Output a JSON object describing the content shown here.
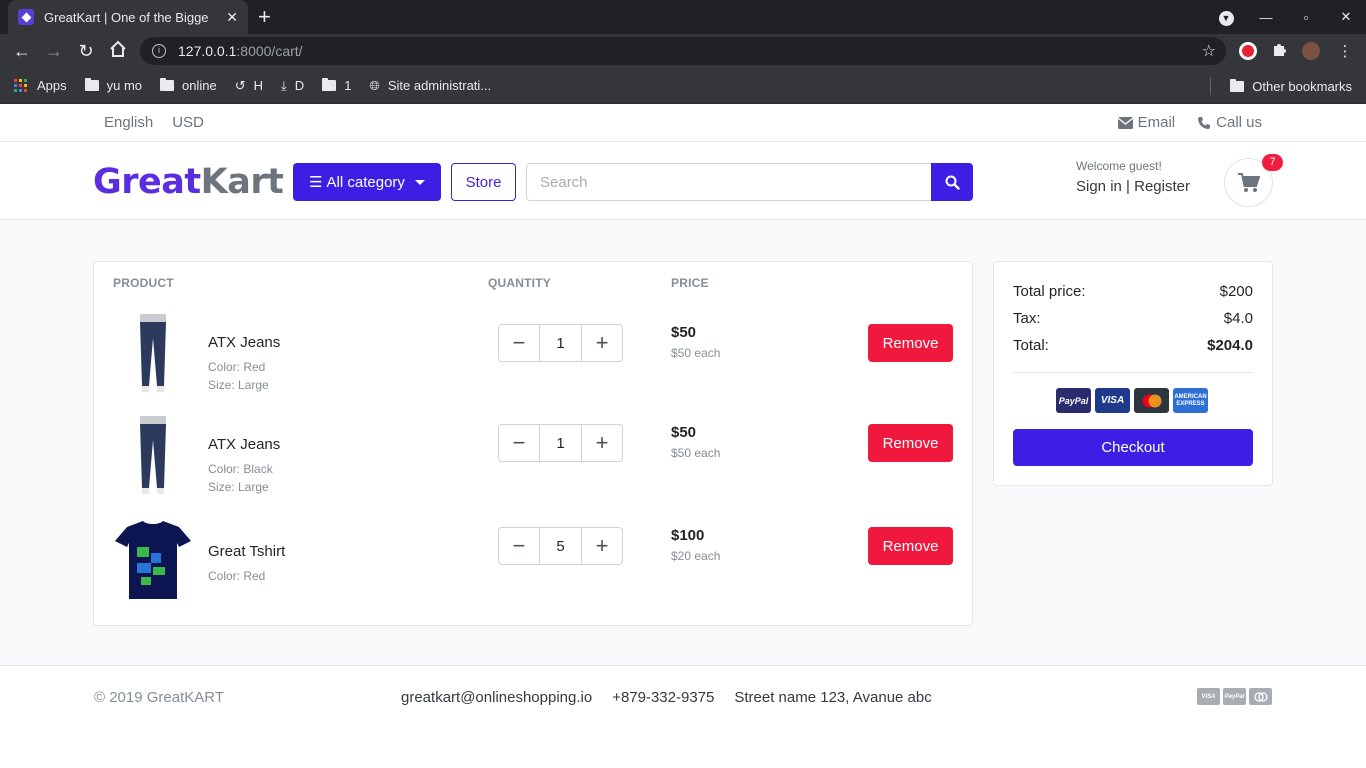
{
  "browser": {
    "tab_title": "GreatKart | One of the Bigge",
    "url_host": "127.0.0.1",
    "url_rest": ":8000/cart/",
    "bookmarks": [
      {
        "label": "Apps"
      },
      {
        "label": "yu mo"
      },
      {
        "label": "online"
      },
      {
        "label": "H"
      },
      {
        "label": "D"
      },
      {
        "label": "1"
      },
      {
        "label": "Site administrati..."
      }
    ],
    "other_bookmarks": "Other bookmarks"
  },
  "topbar": {
    "language": "English",
    "currency": "USD",
    "email": "Email",
    "call": "Call us"
  },
  "header": {
    "logo_part1": "Great",
    "logo_part2": "Kart",
    "category_label": "All category",
    "store_label": "Store",
    "search_placeholder": "Search",
    "welcome": "Welcome guest!",
    "signin": "Sign in",
    "separator": "|",
    "register": "Register",
    "cart_count": "7"
  },
  "cart": {
    "headers": {
      "product": "PRODUCT",
      "quantity": "QUANTITY",
      "price": "PRICE"
    },
    "items": [
      {
        "name": "ATX Jeans",
        "color": "Color: Red",
        "size": "Size: Large",
        "qty": "1",
        "price": "$50",
        "each": "$50 each",
        "remove": "Remove",
        "image": "jeans"
      },
      {
        "name": "ATX Jeans",
        "color": "Color: Black",
        "size": "Size: Large",
        "qty": "1",
        "price": "$50",
        "each": "$50 each",
        "remove": "Remove",
        "image": "jeans"
      },
      {
        "name": "Great Tshirt",
        "color": "Color: Red",
        "size": "",
        "qty": "5",
        "price": "$100",
        "each": "$20 each",
        "remove": "Remove",
        "image": "tshirt"
      }
    ]
  },
  "summary": {
    "total_price_label": "Total price:",
    "total_price_value": "$200",
    "tax_label": "Tax:",
    "tax_value": "$4.0",
    "total_label": "Total:",
    "total_value": "$204.0",
    "payment_cards": [
      "PayPal",
      "VISA",
      "mastercard",
      "AMERICAN EXPRESS"
    ],
    "checkout": "Checkout"
  },
  "footer": {
    "copyright": "© 2019 GreatKART",
    "email": "greatkart@onlineshopping.io",
    "phone": "+879-332-9375",
    "address": "Street name 123, Avanue abc",
    "cards": [
      "VISA",
      "PayPal",
      "mastercard"
    ]
  },
  "colors": {
    "brand": "#3d1ee4",
    "danger": "#f0183c",
    "muted": "#868e96"
  }
}
